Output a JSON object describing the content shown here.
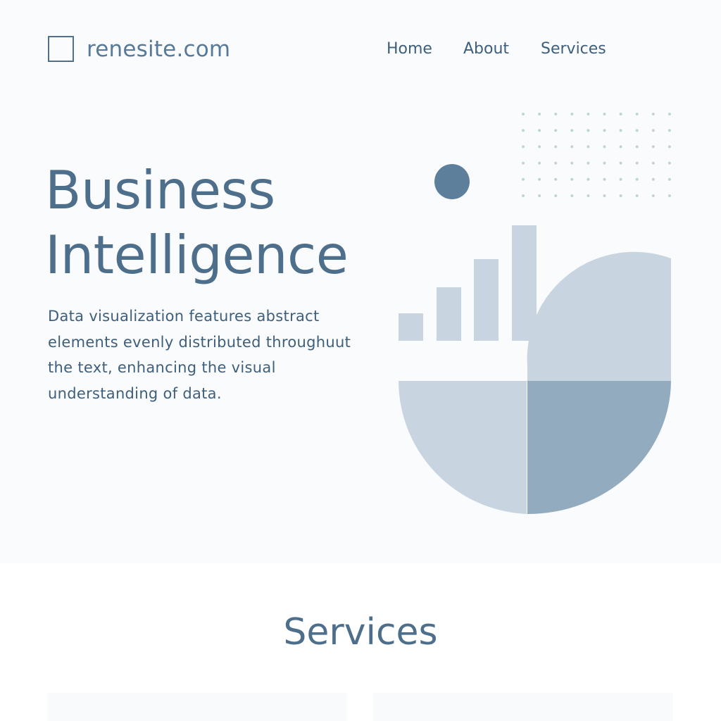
{
  "header": {
    "site_name": "renesite.com",
    "nav": [
      "Home",
      "About",
      "Services"
    ]
  },
  "hero": {
    "title_line1": "Business",
    "title_line2": "Intelligence",
    "description": "Data visualization features abstract elements evenly distributed throughuut the text, enhancing the visual understanding of data."
  },
  "services": {
    "title": "Services"
  },
  "colors": {
    "primary": "#4e6f8c",
    "accent_dot": "#5e7f9b",
    "light_shape": "#c8d5e0",
    "mid_shape": "#93abbe",
    "hero_background": "#fafbfd"
  },
  "icons": {
    "logo": "square-outline-icon"
  }
}
